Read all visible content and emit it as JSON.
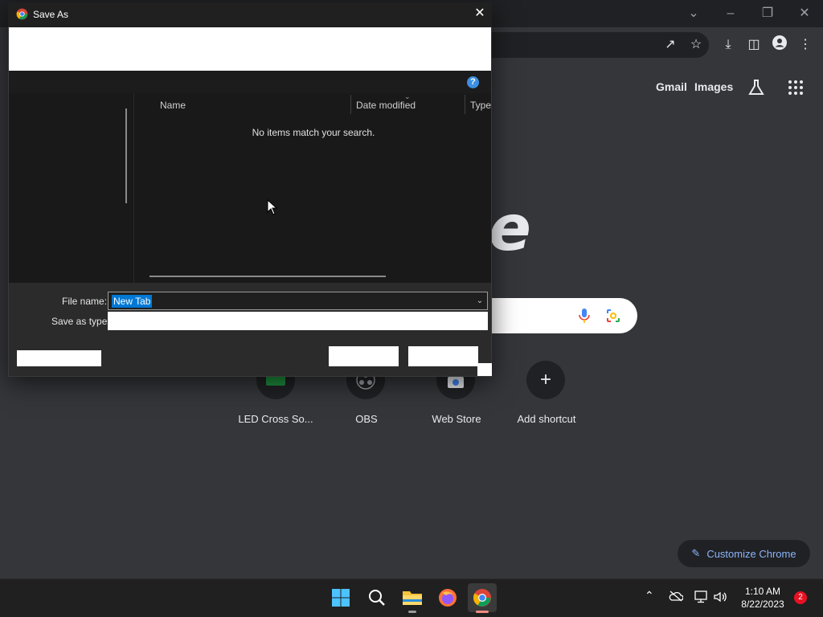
{
  "dialog": {
    "title": "Save As",
    "columns": [
      "Name",
      "Date modified",
      "Type"
    ],
    "empty_message": "No items match your search.",
    "file_name_label": "File name:",
    "file_name_value": "New Tab",
    "save_as_type_label": "Save as type:",
    "help_glyph": "?"
  },
  "ntp": {
    "links": [
      "Gmail",
      "Images"
    ],
    "logo_fragment": "e",
    "shortcuts": [
      {
        "label": "LED Cross So..."
      },
      {
        "label": "OBS"
      },
      {
        "label": "Web Store"
      },
      {
        "label": "Add shortcut"
      }
    ],
    "customize_label": "Customize Chrome"
  },
  "taskbar": {
    "time": "1:10 AM",
    "date": "8/22/2023",
    "notifications": "2"
  },
  "colors": {
    "accent_blue": "#0078d4",
    "chrome_dark": "#35363a",
    "customize_text": "#8ab4f8"
  }
}
